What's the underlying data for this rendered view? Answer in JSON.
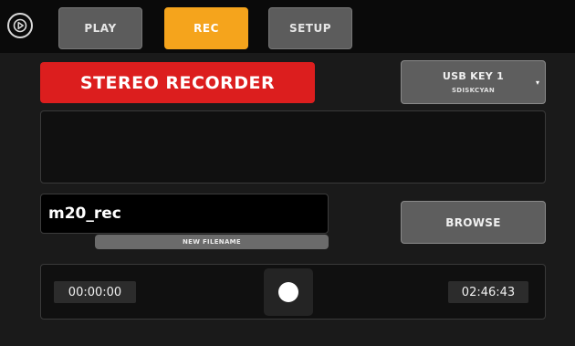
{
  "tabs": [
    {
      "label": "PLAY",
      "active": false
    },
    {
      "label": "REC",
      "active": true
    },
    {
      "label": "SETUP",
      "active": false
    }
  ],
  "logo_icon": "play-circle-icon",
  "recorder": {
    "title": "STEREO RECORDER",
    "device": {
      "label": "USB KEY 1",
      "name": "SDISKCYAN"
    },
    "filename": {
      "value": "m20_rec",
      "label": "NEW FILENAME"
    },
    "browse_label": "BROWSE"
  },
  "transport": {
    "elapsed": "00:00:00",
    "remaining": "02:46:43",
    "record_icon": "record-dot-icon"
  },
  "colors": {
    "active_tab": "#f5a41c",
    "title_badge": "#dc1e1e",
    "background": "#1a1a1a",
    "button": "#5e5e5e"
  }
}
